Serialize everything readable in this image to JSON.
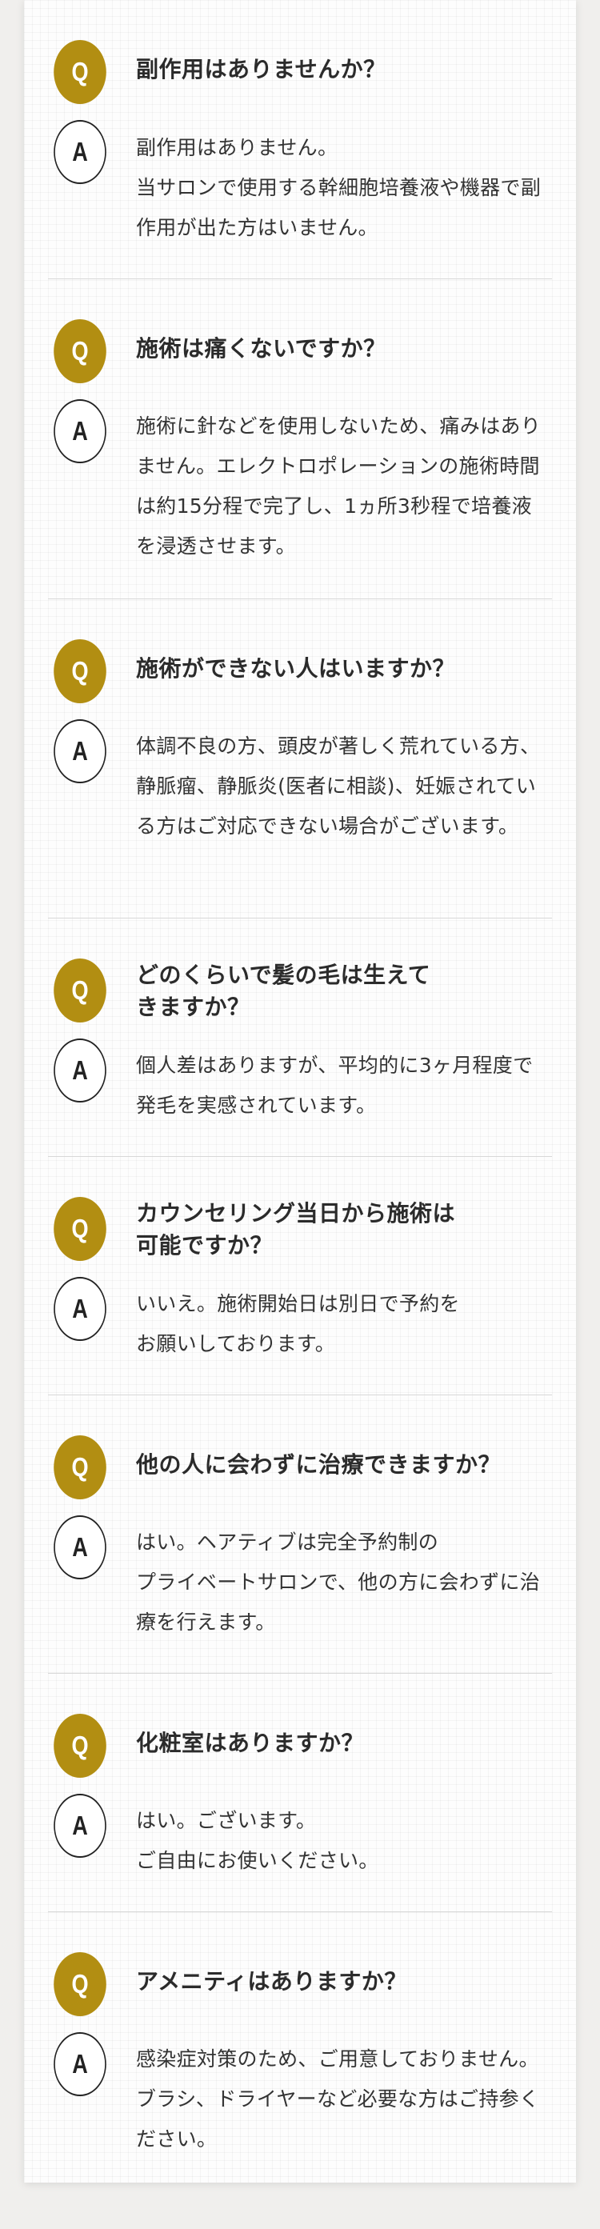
{
  "badges": {
    "q": "Q",
    "a": "A"
  },
  "colors": {
    "accent": "#b28e12",
    "text": "#2b2b2b",
    "divider": "#d8d8d8"
  },
  "faq": [
    {
      "q": "副作用はありませんか？",
      "a": "副作用はありません。\n当サロンで使用する幹細胞培養液や機器で副作用が出た方はいません。"
    },
    {
      "q": "施術は痛くないですか？",
      "a": "施術に針などを使用しないため、痛みはありません。エレクトロポレーションの施術時間は約15分程で完了し、1ヵ所3秒程で培養液を浸透させます。"
    },
    {
      "q": "施術ができない人はいますか？",
      "a": "体調不良の方、頭皮が著しく荒れている方、静脈瘤、静脈炎(医者に相談)、妊娠されている方はご対応できない場合がございます。"
    },
    {
      "q": "どのくらいで髪の毛は生えて\nきますか？",
      "a": "個人差はありますが、平均的に3ヶ月程度で発毛を実感されています。"
    },
    {
      "q": "カウンセリング当日から施術は\n可能ですか？",
      "a": "いいえ。施術開始日は別日で予約を\nお願いしております。"
    },
    {
      "q": "他の人に会わずに治療できますか？",
      "a": "はい。ヘアティブは完全予約制の\nプライベートサロンで、他の方に会わずに治療を行えます。"
    },
    {
      "q": "化粧室はありますか？",
      "a": "はい。ございます。\nご自由にお使いください。"
    },
    {
      "q": "アメニティはありますか？",
      "a": "感染症対策のため、ご用意しておりません。ブラシ、ドライヤーなど必要な方はご持参ください。"
    }
  ]
}
